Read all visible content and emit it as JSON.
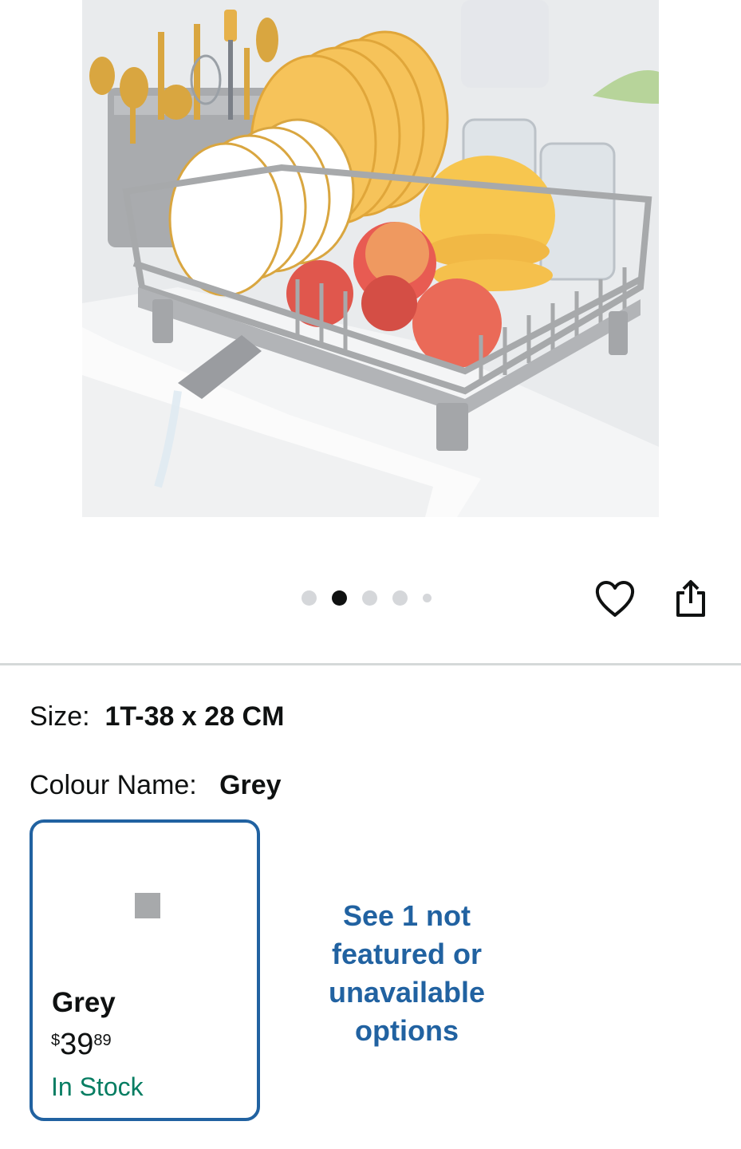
{
  "gallery": {
    "image_alt": "Grey dish drying rack with plates, bowls, glasses, cutlery and apples",
    "dots": [
      {
        "state": "inactive"
      },
      {
        "state": "active"
      },
      {
        "state": "inactive"
      },
      {
        "state": "inactive"
      },
      {
        "state": "small"
      }
    ],
    "heart_icon": "heart-outline-icon",
    "share_icon": "share-icon"
  },
  "variations": {
    "size_label": "Size:",
    "size_value": "1T-38 x 28 CM",
    "colour_label": "Colour Name:",
    "colour_value": "Grey"
  },
  "swatch": {
    "color": "#a7a9ab",
    "name": "Grey",
    "price_symbol": "$",
    "price_whole": "39",
    "price_fraction": "89",
    "stock": "In Stock",
    "border_color": "#2162a1",
    "stock_color": "#067d62"
  },
  "more_options": {
    "line1": "See 1 not",
    "line2": "featured or",
    "line3": "unavailable",
    "line4": "options"
  }
}
